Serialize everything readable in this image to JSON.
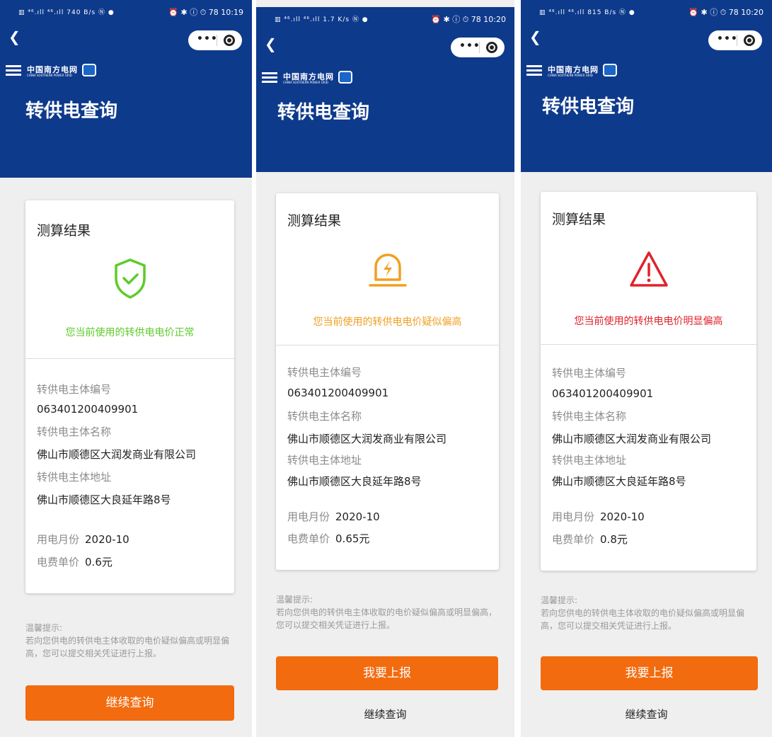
{
  "colors": {
    "header": "#0e3a8c",
    "primary_button": "#f26b0f",
    "normal": "#5ecb2a",
    "suspect": "#f0a020",
    "high": "#e0222a"
  },
  "screens": [
    {
      "status": {
        "left": "▥ ⁴⁶.ıll ⁴⁶.ıll 740 B/s Ⓝ ●",
        "right": "⏰ ✱ ⓘ ⏱ 78 10:19"
      },
      "brand": {
        "cn": "中国南方电网",
        "en": "CHINA SOUTHERN POWER GRID"
      },
      "title": "转供电查询",
      "card_title": "测算结果",
      "result_icon": "shield-check-icon",
      "result_text": "您当前使用的转供电电价正常",
      "entity_no_label": "转供电主体编号",
      "entity_no": "063401200409901",
      "entity_name_label": "转供电主体名称",
      "entity_name": "佛山市顺德区大润发商业有限公司",
      "entity_addr_label": "转供电主体地址",
      "entity_addr": "佛山市顺德区大良延年路8号",
      "month_label": "用电月份",
      "month": "2020-10",
      "price_label": "电费单价",
      "price": "0.6元",
      "tip_title": "温馨提示:",
      "tip_body": "若向您供电的转供电主体收取的电价疑似偏高或明显偏高，您可以提交相关凭证进行上报。",
      "primary_button": "继续查询"
    },
    {
      "status": {
        "left": "▥ ⁴⁶.ıll ⁴⁶.ıll 1.7 K/s Ⓝ ●",
        "right": "⏰ ✱ ⓘ ⏱ 78 10:20"
      },
      "brand": {
        "cn": "中国南方电网",
        "en": "CHINA SOUTHERN POWER GRID"
      },
      "title": "转供电查询",
      "card_title": "测算结果",
      "result_icon": "warning-lamp-icon",
      "result_text": "您当前使用的转供电电价疑似偏高",
      "entity_no_label": "转供电主体编号",
      "entity_no": "063401200409901",
      "entity_name_label": "转供电主体名称",
      "entity_name": "佛山市顺德区大润发商业有限公司",
      "entity_addr_label": "转供电主体地址",
      "entity_addr": "佛山市顺德区大良延年路8号",
      "month_label": "用电月份",
      "month": "2020-10",
      "price_label": "电费单价",
      "price": "0.65元",
      "tip_title": "温馨提示:",
      "tip_body": "若向您供电的转供电主体收取的电价疑似偏高或明显偏高，您可以提交相关凭证进行上报。",
      "primary_button": "我要上报",
      "secondary_link": "继续查询"
    },
    {
      "status": {
        "left": "▥ ⁴⁶.ıll ⁴⁶.ıll 815 B/s Ⓝ ●",
        "right": "⏰ ✱ ⓘ ⏱ 78 10:20"
      },
      "brand": {
        "cn": "中国南方电网",
        "en": "CHINA SOUTHERN POWER GRID"
      },
      "title": "转供电查询",
      "card_title": "测算结果",
      "result_icon": "warning-triangle-icon",
      "result_text": "您当前使用的转供电电价明显偏高",
      "entity_no_label": "转供电主体编号",
      "entity_no": "063401200409901",
      "entity_name_label": "转供电主体名称",
      "entity_name": "佛山市顺德区大润发商业有限公司",
      "entity_addr_label": "转供电主体地址",
      "entity_addr": "佛山市顺德区大良延年路8号",
      "month_label": "用电月份",
      "month": "2020-10",
      "price_label": "电费单价",
      "price": "0.8元",
      "tip_title": "温馨提示:",
      "tip_body": "若向您供电的转供电主体收取的电价疑似偏高或明显偏高，您可以提交相关凭证进行上报。",
      "primary_button": "我要上报",
      "secondary_link": "继续查询"
    }
  ]
}
